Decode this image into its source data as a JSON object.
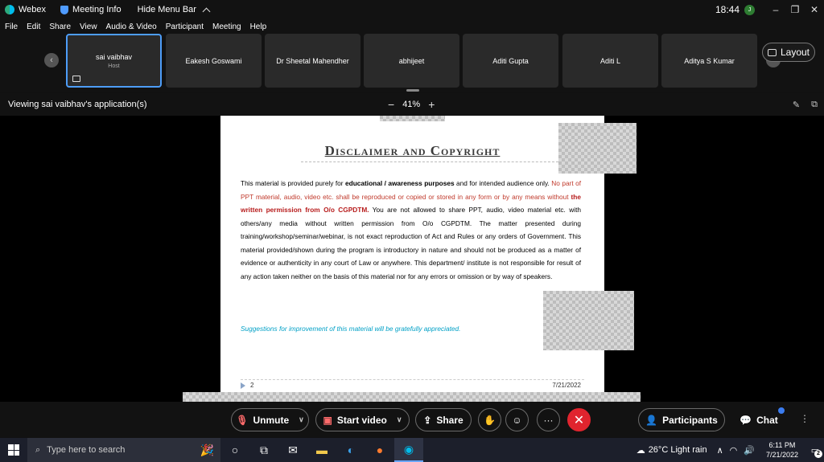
{
  "titlebar": {
    "app_name": "Webex",
    "meeting_info": "Meeting Info",
    "hide_menu_bar": "Hide Menu Bar",
    "clock": "18:44",
    "user_initials": "J",
    "minimize": "–",
    "restore": "❐",
    "close": "✕"
  },
  "menu": [
    "File",
    "Edit",
    "Share",
    "View",
    "Audio & Video",
    "Participant",
    "Meeting",
    "Help"
  ],
  "participants": [
    {
      "name": "sai vaibhav",
      "role": "Host"
    },
    {
      "name": "Eakesh Goswami",
      "role": ""
    },
    {
      "name": "Dr Sheetal Mahendher",
      "role": ""
    },
    {
      "name": "abhijeet",
      "role": ""
    },
    {
      "name": "Aditi Gupta",
      "role": ""
    },
    {
      "name": "Aditi L",
      "role": ""
    },
    {
      "name": "Aditya S Kumar",
      "role": ""
    }
  ],
  "layout_label": "Layout",
  "viewing_text": "Viewing sai vaibhav's application(s)",
  "zoom": {
    "minus": "−",
    "value": "41%",
    "plus": "+"
  },
  "slide": {
    "title": "Disclaimer and Copyright",
    "p1": "This material is provided  purely for ",
    "p1_bold": "educational / awareness purposes",
    "p2": " and for intended audience only. ",
    "p3_red": "No part of PPT material, audio, video etc. shall be reproduced or copied or stored in any form or by any means without ",
    "p4_redbold": "the written permission from O/o CGPDTM.",
    "p5": " You are not allowed to share PPT, audio, video material etc. with others/any media without written permission from O/o CGPDTM. The matter presented during training/workshop/seminar/webinar, is not exact reproduction of Act and Rules or any orders of Government. This material provided/shown during the program is introductory in nature and should not be produced as a matter of evidence or authenticity in any court of Law or anywhere. This department/ institute is not responsible for result of any action taken neither on the basis of this material nor for any errors or omission or by way of speakers.",
    "suggestion": "Suggestions for improvement of this material will be gratefully appreciated.",
    "page_number": "2",
    "date": "7/21/2022"
  },
  "controls": {
    "unmute": "Unmute",
    "start_video": "Start video",
    "share": "Share",
    "more": "···",
    "leave": "✕",
    "participants": "Participants",
    "chat": "Chat"
  },
  "taskbar": {
    "search_placeholder": "Type here to search",
    "weather": "26°C  Light rain",
    "time": "6:11 PM",
    "date": "7/21/2022",
    "notifications": "2"
  }
}
